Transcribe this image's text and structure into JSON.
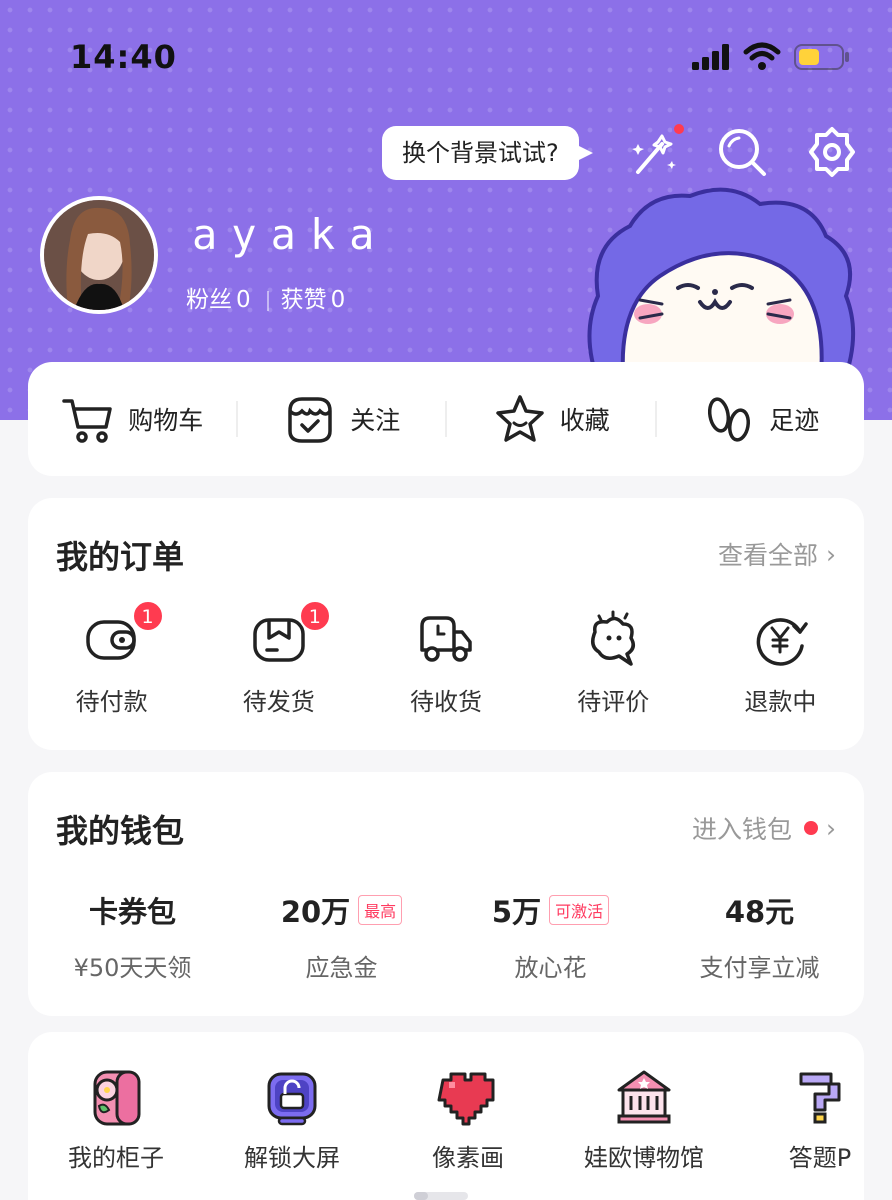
{
  "status_bar": {
    "time": "14:40"
  },
  "header": {
    "bg_tip": "换个背景试试?",
    "username": "ayaka",
    "fans_label": "粉丝",
    "fans_count": "0",
    "likes_label": "获赞",
    "likes_count": "0"
  },
  "quick_nav": [
    {
      "label": "购物车",
      "icon": "cart-icon"
    },
    {
      "label": "关注",
      "icon": "shop-follow-icon"
    },
    {
      "label": "收藏",
      "icon": "star-icon"
    },
    {
      "label": "足迹",
      "icon": "footprint-icon"
    }
  ],
  "orders": {
    "title": "我的订单",
    "view_all": "查看全部",
    "items": [
      {
        "label": "待付款",
        "badge": "1",
        "icon": "wallet-icon"
      },
      {
        "label": "待发货",
        "badge": "1",
        "icon": "package-icon"
      },
      {
        "label": "待收货",
        "badge": "",
        "icon": "delivery-truck-icon"
      },
      {
        "label": "待评价",
        "badge": "",
        "icon": "comment-icon"
      },
      {
        "label": "退款中",
        "badge": "",
        "icon": "refund-yen-icon"
      }
    ]
  },
  "wallet": {
    "title": "我的钱包",
    "enter": "进入钱包",
    "items": [
      {
        "value": "卡券包",
        "tag": "",
        "label": "¥50天天领"
      },
      {
        "value": "20万",
        "tag": "最高",
        "label": "应急金"
      },
      {
        "value": "5万",
        "tag": "可激活",
        "label": "放心花"
      },
      {
        "value": "48元",
        "tag": "",
        "label": "支付享立减"
      }
    ]
  },
  "tools": [
    {
      "label": "我的柜子",
      "icon": "cabinet-icon"
    },
    {
      "label": "解锁大屏",
      "icon": "unlock-screen-icon"
    },
    {
      "label": "像素画",
      "icon": "pixel-heart-icon"
    },
    {
      "label": "娃欧博物馆",
      "icon": "museum-icon"
    },
    {
      "label": "答题P",
      "icon": "quiz-icon"
    }
  ],
  "colors": {
    "header_bg": "#8c70e8",
    "badge": "#ff3b50",
    "text": "#222222"
  }
}
